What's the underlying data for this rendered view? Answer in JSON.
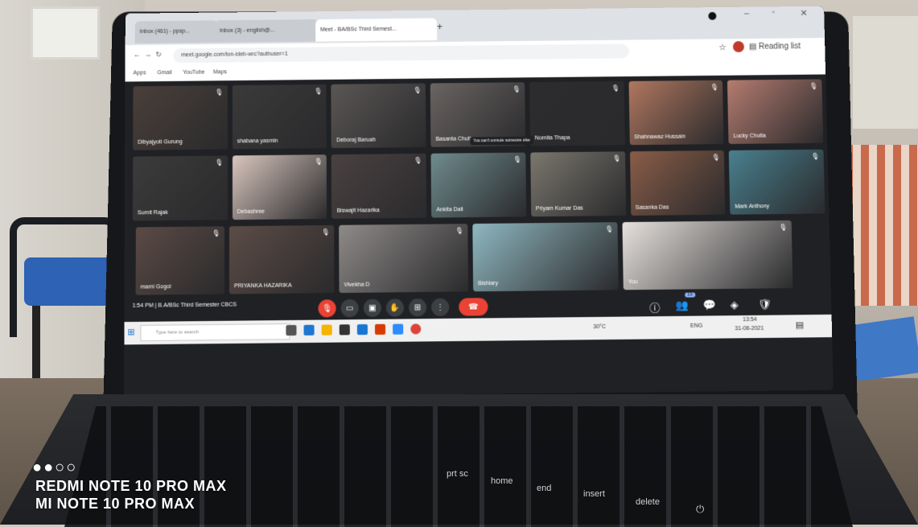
{
  "browser": {
    "tabs": [
      {
        "label": "Inbox (461) - ppsp..."
      },
      {
        "label": "Inbox (3) - english@..."
      },
      {
        "label": "Meet - BA/BSc Third Semest..."
      }
    ],
    "url": "meet.google.com/ton-ideb-wrc?authuser=1",
    "bookmarks": [
      "Apps",
      "Gmail",
      "YouTube",
      "Maps"
    ],
    "reading_list": "Reading list"
  },
  "meet": {
    "participants": [
      {
        "name": "Dibyajyoti Gurung",
        "color": "#4a3f3a"
      },
      {
        "name": "shabana yasmin",
        "color": "#3a3a3a"
      },
      {
        "name": "Deboraj Baruah",
        "color": "#5a5654"
      },
      {
        "name": "Basanta Chutia",
        "color": "#6a6462"
      },
      {
        "name": "Nomita Thapa",
        "color": "#2c2c2e"
      },
      {
        "name": "Shahnawaz Hussain",
        "color": "#b0775f"
      },
      {
        "name": "Lucky Chutia",
        "color": "#b57c70"
      },
      {
        "name": "Sumit Rajak",
        "color": "#3b3b3b"
      },
      {
        "name": "Debashree",
        "color": "#d9c6be"
      },
      {
        "name": "Biswajit Hazarika",
        "color": "#4a4141"
      },
      {
        "name": "Ankita Dali",
        "color": "#6f8b8e"
      },
      {
        "name": "Priyam Kumar Das",
        "color": "#7b776e"
      },
      {
        "name": "Sasanka Das",
        "color": "#8a5d47"
      },
      {
        "name": "Mark Anthony",
        "color": "#49808f"
      },
      {
        "name": "mami Gogoi",
        "color": "#5b4a45"
      },
      {
        "name": "PRIYANKA HAZARIKA",
        "color": "#5c4c46"
      },
      {
        "name": "Vivekha D",
        "color": "#8e8a88"
      },
      {
        "name": "Bishlary",
        "color": "#8fb7c0"
      },
      {
        "name": "You",
        "color": "#e6e1dd"
      }
    ],
    "tooltip": "You can't unmute someone else",
    "time": "1:54 PM",
    "meeting_title": "B.A/BSc Third Semester CBCS",
    "people_count": "19"
  },
  "taskbar": {
    "search_placeholder": "Type here to search",
    "temperature": "30°C",
    "language": "ENG",
    "clock_time": "13:54",
    "clock_date": "31-08-2021"
  },
  "watermark": {
    "dots": "●●○○",
    "line1": "REDMI NOTE 10 PRO MAX",
    "line2": "MI NOTE 10 PRO MAX"
  },
  "keyboard": {
    "labels": [
      "prt sc",
      "home",
      "end",
      "insert",
      "delete"
    ]
  }
}
